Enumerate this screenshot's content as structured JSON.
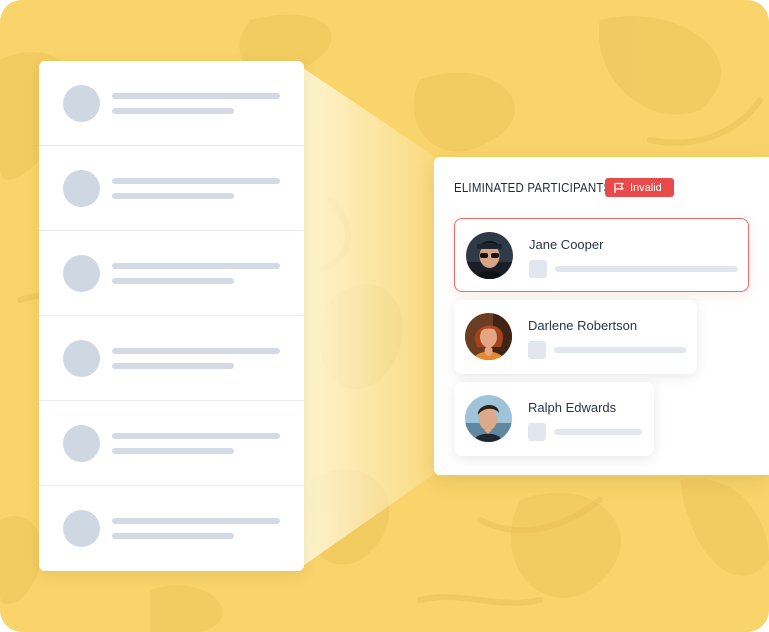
{
  "panel": {
    "title": "ELIMINATED PARTICIPANTS",
    "badge": {
      "label": "Invalid",
      "icon": "flag-icon",
      "color": "#e94a4a"
    }
  },
  "participants": [
    {
      "name": "Jane Cooper",
      "selected": true
    },
    {
      "name": "Darlene Robertson",
      "selected": false
    },
    {
      "name": "Ralph Edwards",
      "selected": false
    }
  ],
  "skeleton_rows": 6,
  "colors": {
    "background": "#f8d46a",
    "highlight_border": "#ec6b6b",
    "skeleton": "#d3dae5"
  }
}
